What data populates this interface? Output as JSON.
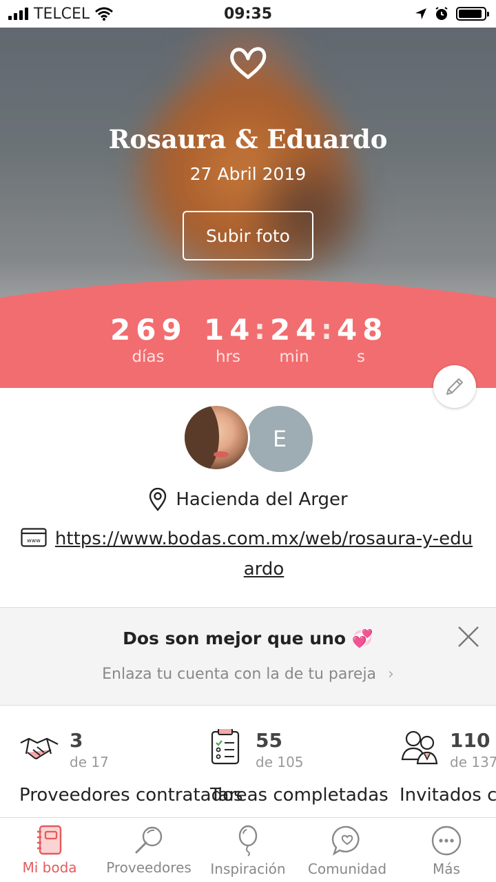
{
  "status_bar": {
    "carrier": "TELCEL",
    "time": "09:35"
  },
  "hero": {
    "couple_names": "Rosaura & Eduardo",
    "wedding_date": "27 Abril 2019",
    "upload_button": "Subir foto"
  },
  "countdown": {
    "days": "269",
    "days_label": "días",
    "hours": "14",
    "hours_label": "hrs",
    "minutes": "24",
    "minutes_label": "min",
    "seconds": "48",
    "seconds_label": "s",
    "separator": ":"
  },
  "profile": {
    "partner_initial": "E",
    "venue": "Hacienda del Arger",
    "website": "https://www.bodas.com.mx/web/rosaura-y-eduardo"
  },
  "partner_banner": {
    "title": "Dos son mejor que uno 💞",
    "subtitle": "Enlaza tu cuenta con la de tu pareja",
    "chevron": "›"
  },
  "stats": [
    {
      "icon": "handshake-icon",
      "count": "3",
      "of": "de 17",
      "label": "Proveedores contratados"
    },
    {
      "icon": "clipboard-checklist-icon",
      "count": "55",
      "of": "de 105",
      "label": "Tareas completadas"
    },
    {
      "icon": "guests-icon",
      "count": "110",
      "of": "de 137",
      "label": "Invitados confirmados"
    }
  ],
  "tabs": [
    {
      "label": "Mi boda",
      "icon": "notebook-icon",
      "active": true
    },
    {
      "label": "Proveedores",
      "icon": "magnifier-icon",
      "active": false
    },
    {
      "label": "Inspiración",
      "icon": "balloon-icon",
      "active": false
    },
    {
      "label": "Comunidad",
      "icon": "chat-heart-icon",
      "active": false
    },
    {
      "label": "Más",
      "icon": "more-dots-icon",
      "active": false
    }
  ],
  "colors": {
    "accent": "#f26d6f",
    "tab_active": "#e45a5c"
  }
}
